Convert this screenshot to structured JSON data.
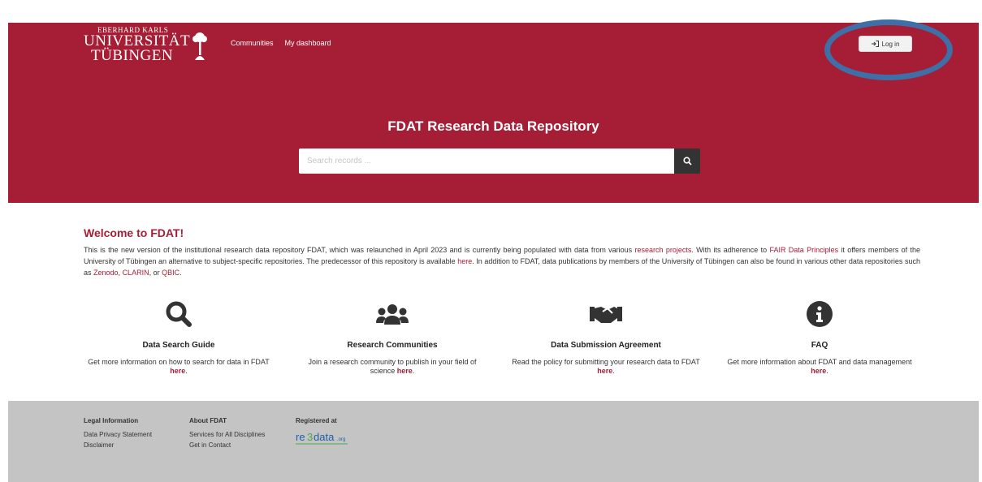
{
  "header": {
    "logo": {
      "line1": "EBERHARD KARLS",
      "line2": "UNIVERSITÄT",
      "line3": "TÜBINGEN"
    },
    "nav": [
      {
        "label": "Communities"
      },
      {
        "label": "My dashboard"
      }
    ],
    "login_label": "Log in",
    "title": "FDAT Research Data Repository",
    "search_placeholder": "Search records ..."
  },
  "welcome": {
    "title": "Welcome to FDAT!",
    "p1": "This is the new version of the institutional research data repository FDAT, which was relaunched in April 2023 and is currently being populated with data from various ",
    "link_research": "research projects",
    "p2": ". With its adherence to ",
    "link_fair": "FAIR Data Principles",
    "p3": " it offers members of the University of Tübingen an alternative to subject-specific repositories. The predecessor of this repository is available ",
    "link_here": "here",
    "p4": ". In addition to FDAT, data publications by members of the University of Tübingen can also be found in various other data repositories such as ",
    "link_zenodo": "Zenodo",
    "sep1": ", ",
    "link_clarin": "CLARIN",
    "sep2": ", or ",
    "link_qbic": "QBIC",
    "end": "."
  },
  "features": [
    {
      "icon": "search-icon",
      "title": "Data Search Guide",
      "desc": "Get more information on how to search for data in FDAT ",
      "link": "here",
      "end": "."
    },
    {
      "icon": "users-icon",
      "title": "Research Communities",
      "desc": "Join a research community to publish in your field of science ",
      "link": "here",
      "end": "."
    },
    {
      "icon": "handshake-icon",
      "title": "Data Submission Agreement",
      "desc": "Read the policy for submitting your research data to FDAT ",
      "link": "here",
      "end": "."
    },
    {
      "icon": "info-icon",
      "title": "FAQ",
      "desc": "Get more information about FDAT and data management ",
      "link": "here",
      "end": "."
    }
  ],
  "footer": {
    "legal": {
      "heading": "Legal Information",
      "links": [
        "Data Privacy Statement",
        "Disclaimer"
      ]
    },
    "about": {
      "heading": "About FDAT",
      "links": [
        "Services for All Disciplines",
        "Get in Contact"
      ]
    },
    "registered": {
      "heading": "Registered at",
      "badge": "re3data.org"
    }
  },
  "colors": {
    "brand": "#a51e36",
    "highlight": "#3e6fa6",
    "footer": "#c4c4c4"
  }
}
